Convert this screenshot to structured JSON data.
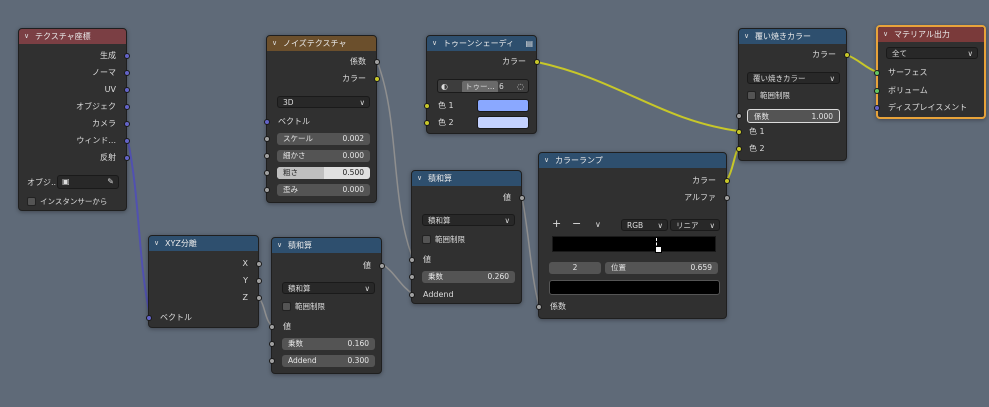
{
  "colors": {
    "bg": "#5f6a78",
    "node": "#303030",
    "vector": "#6363c7",
    "color": "#c7c729",
    "float": "#a1a1a1",
    "shader": "#63c763",
    "selected": "#e8a33a"
  },
  "texcoord": {
    "title": "テクスチャ座標",
    "outputs": [
      "生成",
      "ノーマ",
      "UV",
      "オブジェク",
      "カメラ",
      "ウィンド...",
      "反射"
    ],
    "object_label": "オブジ...",
    "instancer_label": "インスタンサーから"
  },
  "noise": {
    "title": "ノイズテクスチャ",
    "outputs": [
      "係数",
      "カラー"
    ],
    "dimension": "3D",
    "vector_label": "ベクトル",
    "fields": [
      {
        "label": "スケール",
        "value": "0.002"
      },
      {
        "label": "細かさ",
        "value": "0.000"
      },
      {
        "label": "粗さ",
        "value": "0.500"
      },
      {
        "label": "歪み",
        "value": "0.000"
      }
    ]
  },
  "toon": {
    "title": "トゥーンシェーディ",
    "output": "カラー",
    "mode_label": "トゥー...",
    "mode_num": "6",
    "color1_label": "色 1",
    "color2_label": "色 2",
    "color1": "#8aa8ff",
    "color2": "#c4d2ff"
  },
  "mix": {
    "title": "覆い焼きカラー",
    "output": "カラー",
    "blend": "覆い焼きカラー",
    "clamp_label": "範囲制限",
    "factor_label": "係数",
    "factor_value": "1.000",
    "color1_label": "色 1",
    "color2_label": "色 2"
  },
  "output": {
    "title": "マテリアル出力",
    "target": "全て",
    "inputs": [
      "サーフェス",
      "ボリューム",
      "ディスプレイスメント"
    ]
  },
  "sep": {
    "title": "XYZ分離",
    "outputs": [
      "X",
      "Y",
      "Z"
    ],
    "input": "ベクトル"
  },
  "math1": {
    "title": "積和算",
    "output": "値",
    "operation": "積和算",
    "clamp_label": "範囲制限",
    "input_label": "値",
    "fields": [
      {
        "label": "乗数",
        "value": "0.160"
      },
      {
        "label": "Addend",
        "value": "0.300"
      }
    ]
  },
  "math2": {
    "title": "積和算",
    "output": "値",
    "operation": "積和算",
    "clamp_label": "範囲制限",
    "input_label": "値",
    "fields": [
      {
        "label": "乗数",
        "value": "0.260"
      }
    ],
    "addend_label": "Addend"
  },
  "ramp": {
    "title": "カラーランプ",
    "outputs": [
      "カラー",
      "アルファ"
    ],
    "add": "+",
    "remove": "−",
    "menu": "∨",
    "mode": "RGB",
    "interp": "リニア",
    "index": "2",
    "pos_label": "位置",
    "pos_value": "0.659",
    "input": "係数"
  }
}
